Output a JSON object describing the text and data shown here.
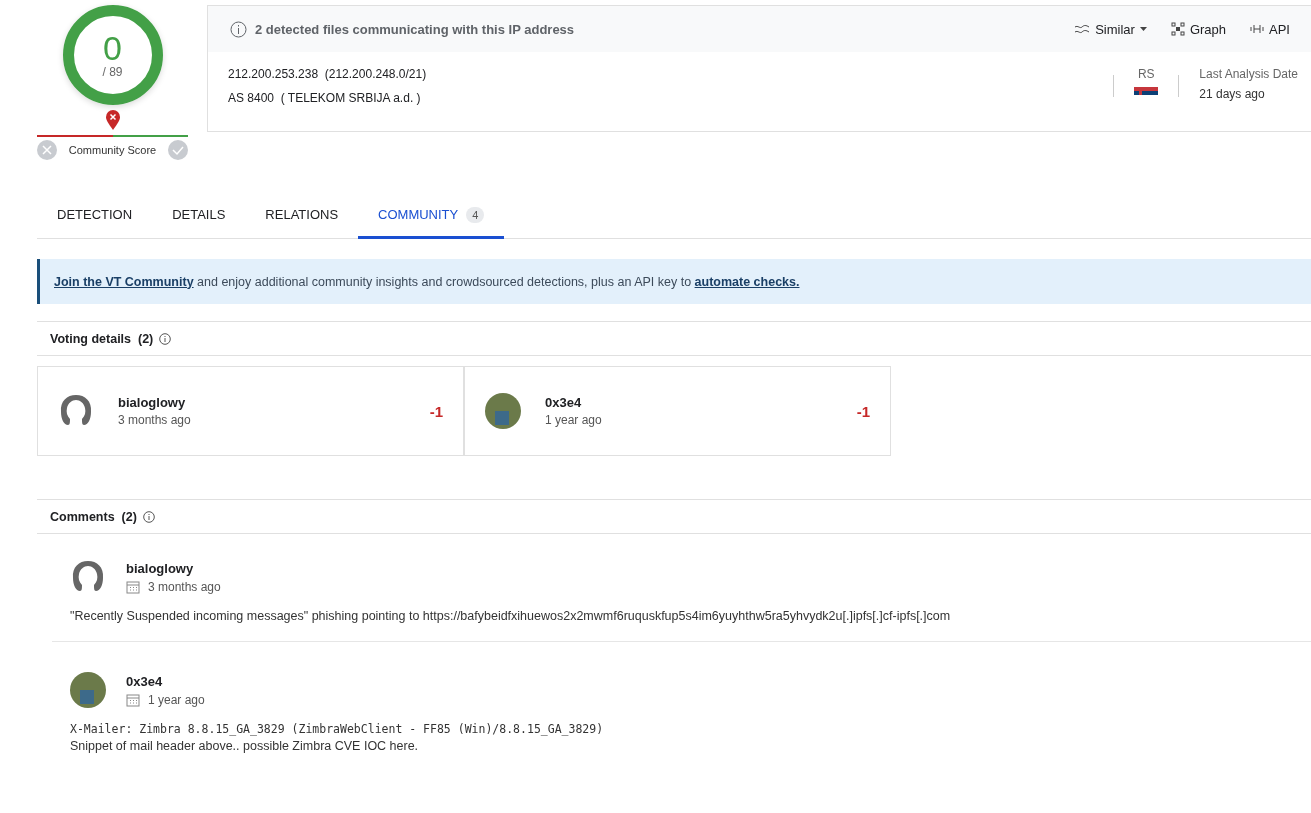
{
  "score": {
    "detections": "0",
    "total": "/ 89",
    "community_label": "Community Score",
    "level": 0.5
  },
  "header": {
    "notice": "2 detected files communicating with this IP address",
    "actions": [
      {
        "kind": "similar",
        "label": "Similar"
      },
      {
        "kind": "graph",
        "label": "Graph"
      },
      {
        "kind": "api",
        "label": "API"
      }
    ],
    "ip": "212.200.253.238",
    "network": "(212.200.248.0/21)",
    "asn": "AS 8400",
    "owner": "( TELEKOM SRBIJA a.d. )",
    "country": "RS",
    "last_analysis_label": "Last Analysis Date",
    "last_analysis_value": "21 days ago"
  },
  "tabs": [
    {
      "label": "DETECTION",
      "selected": false
    },
    {
      "label": "DETAILS",
      "selected": false
    },
    {
      "label": "RELATIONS",
      "selected": false
    },
    {
      "label": "COMMUNITY",
      "count": "4",
      "selected": true
    }
  ],
  "banner": {
    "link": "Join the VT Community",
    "text": " and enjoy additional community insights and crowdsourced detections, plus an API key to ",
    "link2": "automate checks."
  },
  "voting": {
    "title": "Voting details",
    "count": "(2)",
    "votes": [
      {
        "user": "bialoglowy",
        "kind": "silhouette",
        "time": "3 months ago",
        "vote": "-1"
      },
      {
        "user": "0x3e4",
        "kind": "photo",
        "time": "1 year ago",
        "vote": "-1"
      }
    ]
  },
  "comments": {
    "title": "Comments",
    "count": "(2)",
    "items": [
      {
        "user": "bialoglowy",
        "kind": "silhouette",
        "time": "3 months ago",
        "lines": [
          {
            "kind": "text",
            "text": "\"Recently Suspended incoming messages\" phishing pointing to https://bafybeidfxihuewos2x2mwmf6ruquskfup5s4im6yuyhthw5ra5yhvydk2u[.]ipfs[.]cf-ipfs[.]com"
          }
        ]
      },
      {
        "user": "0x3e4",
        "kind": "photo",
        "time": "1 year ago",
        "lines": [
          {
            "kind": "code",
            "text": "X-Mailer: Zimbra 8.8.15_GA_3829 (ZimbraWebClient - FF85 (Win)/8.8.15_GA_3829)"
          },
          {
            "kind": "text",
            "text": "Snippet of mail header above.. possible Zimbra CVE IOC here."
          }
        ]
      }
    ]
  }
}
